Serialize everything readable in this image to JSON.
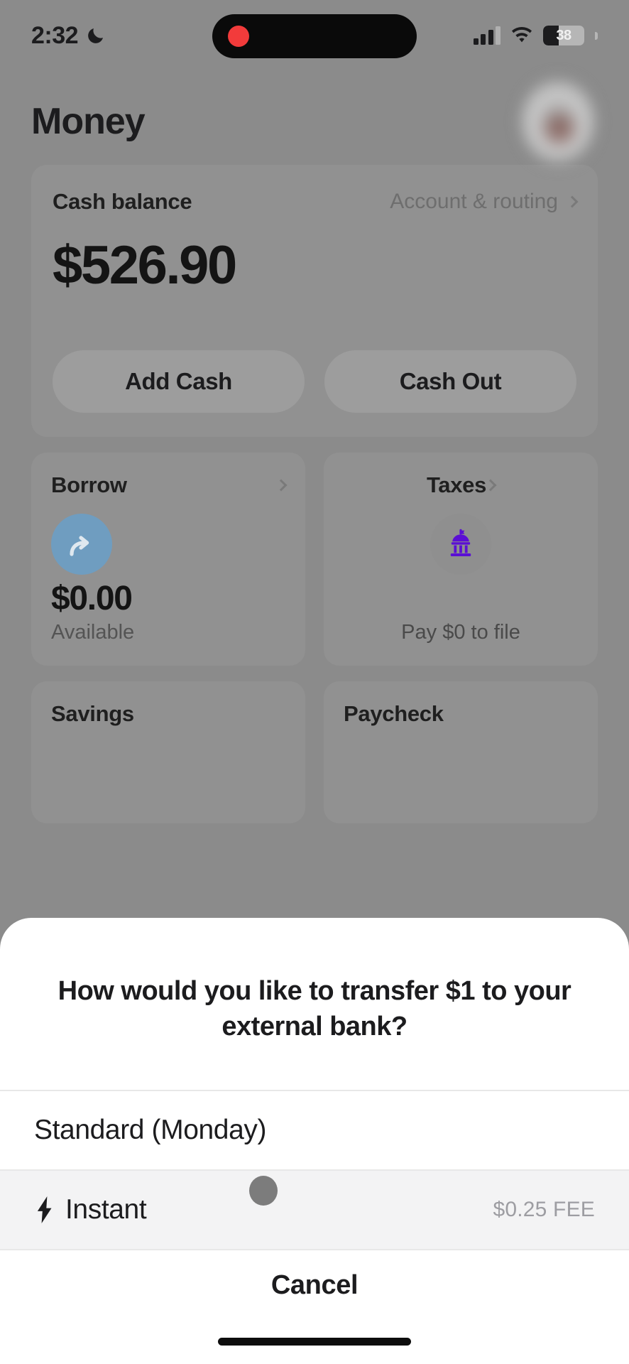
{
  "status_bar": {
    "time": "2:32",
    "dnd_icon": "moon-icon",
    "recording_icon": "record-dot-icon",
    "signal_icon": "cellular-signal-icon",
    "wifi_icon": "wifi-icon",
    "battery_level": "38"
  },
  "header": {
    "title": "Money",
    "avatar_label": ""
  },
  "balance_card": {
    "label": "Cash balance",
    "link_label": "Account & routing",
    "amount": "$526.90",
    "add_cash_label": "Add Cash",
    "cash_out_label": "Cash Out"
  },
  "tiles": [
    {
      "title": "Borrow",
      "icon": "forward-arrow-icon",
      "amount": "$0.00",
      "sub": "Available"
    },
    {
      "title": "Taxes",
      "icon": "government-building-icon",
      "amount": "",
      "sub": "Pay $0 to file"
    }
  ],
  "tiles_partial": [
    {
      "title": "Savings"
    },
    {
      "title": "Paycheck"
    }
  ],
  "sheet": {
    "title": "How would you like to transfer $1 to your external bank?",
    "options": [
      {
        "label": "Standard (Monday)",
        "fee": "",
        "icon": ""
      },
      {
        "label": "Instant",
        "fee": "$0.25 FEE",
        "icon": "bolt-icon"
      }
    ],
    "cancel_label": "Cancel"
  },
  "colors": {
    "dim_overlay": "#8b8b8b",
    "card": "#919191",
    "sheet_bg": "#ffffff",
    "pressed_row": "#f3f3f4",
    "borrow_icon_bg": "#6f9dc0",
    "taxes_icon": "#5b0fd4",
    "fee_text": "#9d9da2",
    "record_dot": "#f23b3b"
  }
}
